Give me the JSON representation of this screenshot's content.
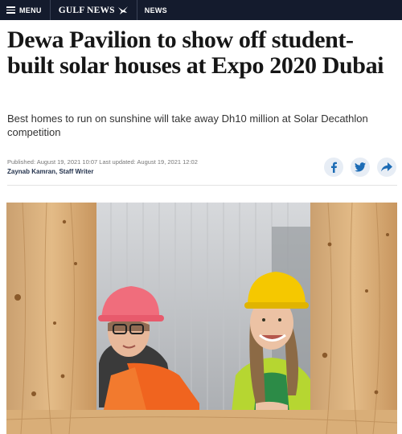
{
  "topbar": {
    "menu_label": "MENU",
    "brand": "GULF NEWS",
    "section": "NEWS"
  },
  "article": {
    "headline": "Dewa Pavilion to show off student-built solar houses at Expo 2020 Dubai",
    "subheadline": "Best homes to run on sunshine will take away Dh10 million at Solar Decathlon competition",
    "published_label": "Published:",
    "published": "August 19, 2021 10:07",
    "updated_label": "Last updated:",
    "updated": "August 19, 2021 12:02",
    "author": "Zaynab Kamran, Staff Writer"
  },
  "share": {
    "icons": [
      "facebook-icon",
      "twitter-icon",
      "share-arrow-icon"
    ],
    "icon_color": "#1d6cb5"
  },
  "photo": {
    "subject": "two women in hard hats smiling through a wooden frame opening",
    "colors": {
      "wood": "#d6a872",
      "helmet_left": "#f06d7c",
      "helmet_right": "#f5c800",
      "jacket_left": "#f0641f",
      "vest_right": "#b6d631"
    }
  }
}
